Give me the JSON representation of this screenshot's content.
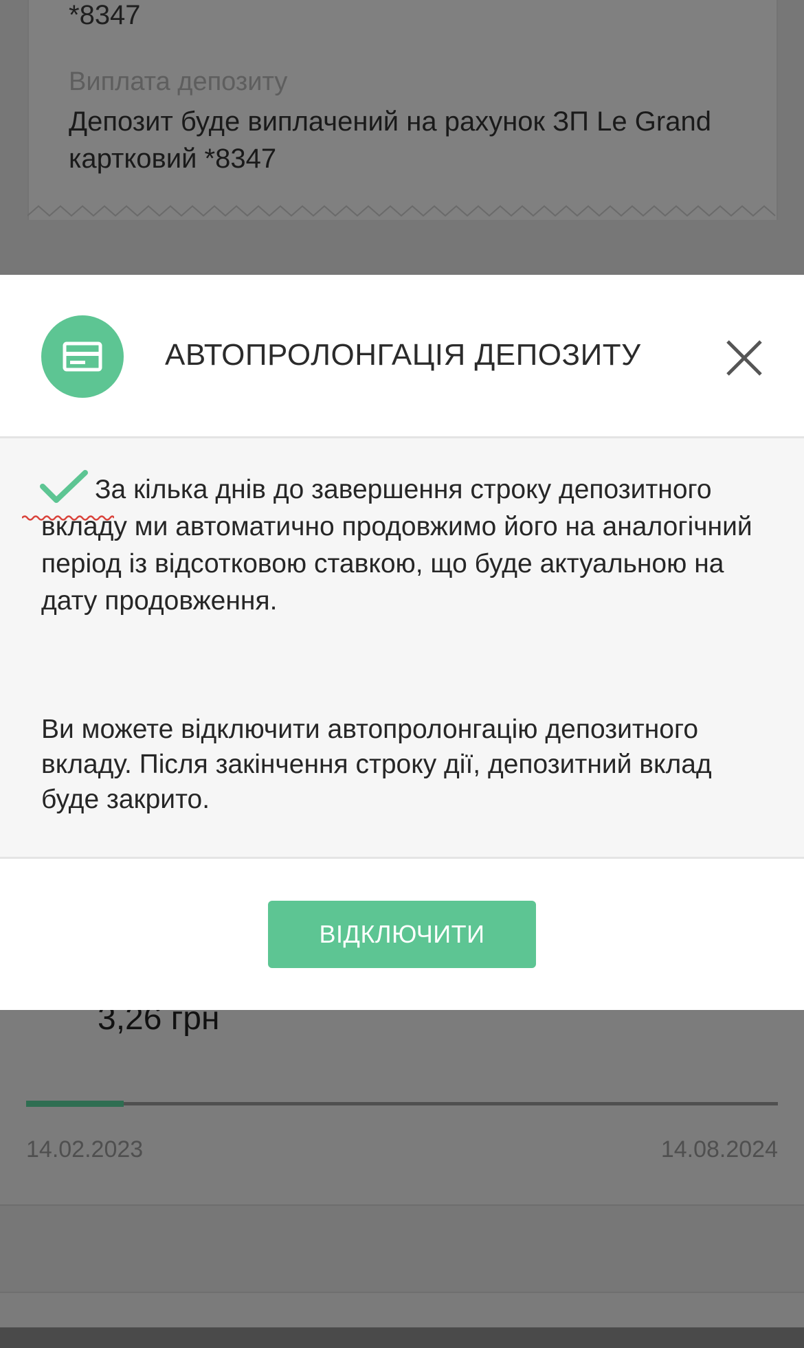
{
  "background": {
    "account_suffix": "*8347",
    "payout_label": "Виплата депозиту",
    "payout_text": "Депозит буде виплачений на рахунок ЗП Le Grand картковий *8347",
    "amount": "3,26 грн",
    "progress_fraction": 0.13,
    "date_start": "14.02.2023",
    "date_end": "14.08.2024"
  },
  "modal": {
    "icon": "credit-card-icon",
    "title": "АВТОПРОЛОНГАЦІЯ ДЕПОЗИТУ",
    "close_icon": "close-icon",
    "paragraph1": "За кілька днів до завершення строку депозитного вкладу ми автоматично продовжимо його на аналогічний період із відсотковою ставкою, що буде актуальною на дату продовження.",
    "paragraph2": "Ви можете відключити автопролонгацію депозитного вкладу. Після закінчення строку дії, депозитний вклад буде закрито.",
    "disable_button": "ВІДКЛЮЧИТИ"
  },
  "colors": {
    "accent": "#5dc593",
    "overlay": "#777777",
    "progress_fill": "#2f6e52"
  }
}
